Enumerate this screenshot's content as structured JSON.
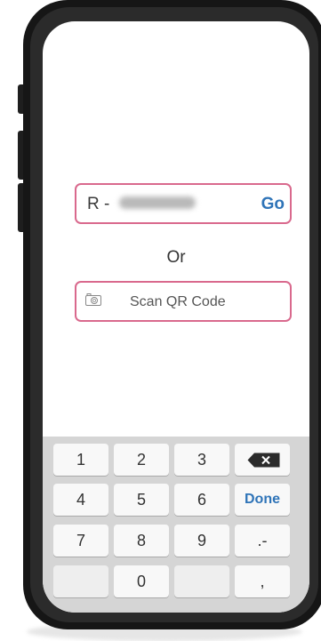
{
  "reference": {
    "prefix": "R -",
    "go_label": "Go"
  },
  "separator": "Or",
  "scan": {
    "label": "Scan QR Code",
    "icon": "camera-icon"
  },
  "keypad": {
    "keys": [
      "1",
      "2",
      "3",
      "4",
      "5",
      "6",
      "7",
      "8",
      "9",
      "0"
    ],
    "done_label": "Done",
    "punct_label": ".-",
    "comma_label": ",",
    "backspace_icon": "backspace-icon"
  },
  "colors": {
    "accent": "#2f74b8",
    "field_border": "#d9698d"
  }
}
